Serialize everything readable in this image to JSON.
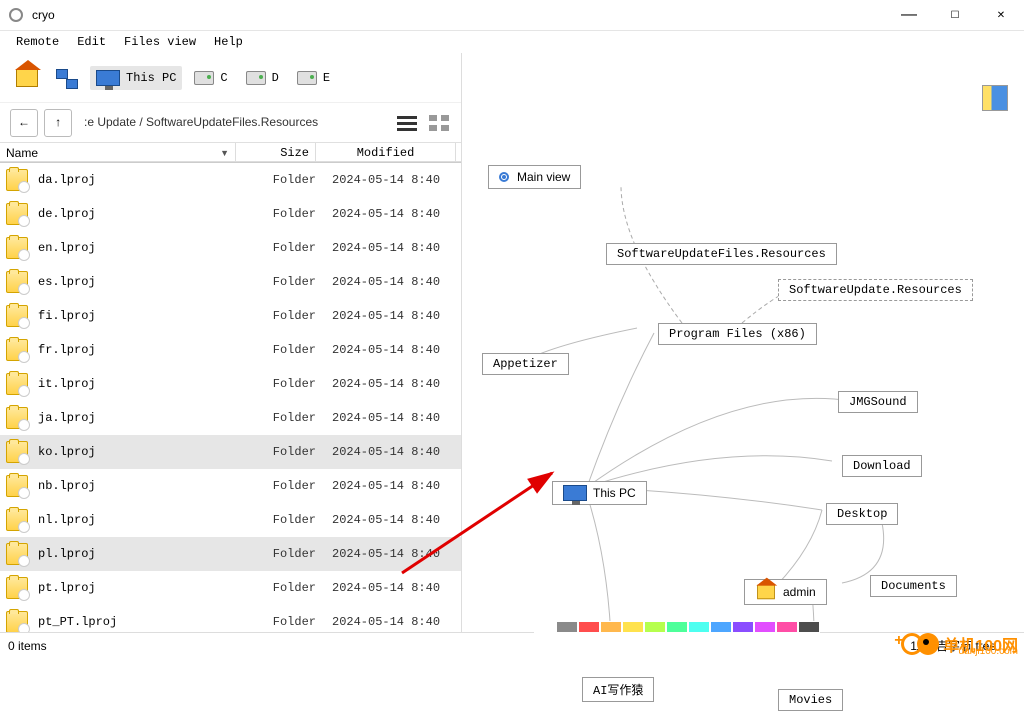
{
  "window": {
    "title": "cryo"
  },
  "menubar": {
    "items": [
      "Remote",
      "Edit",
      "Files view",
      "Help"
    ]
  },
  "toolbar": {
    "home": "",
    "thispc_label": "This PC",
    "drives": [
      {
        "label": "C"
      },
      {
        "label": "D"
      },
      {
        "label": "E"
      }
    ]
  },
  "nav": {
    "back": "←",
    "up": "↑",
    "breadcrumb_prefix": ":e Update / ",
    "breadcrumb": "SoftwareUpdateFiles.Resources"
  },
  "columns": {
    "name": "Name",
    "size": "Size",
    "modified": "Modified"
  },
  "rows": [
    {
      "name": "da.lproj",
      "size": "Folder",
      "modified": "2024-05-14  8:40",
      "selected": false
    },
    {
      "name": "de.lproj",
      "size": "Folder",
      "modified": "2024-05-14  8:40",
      "selected": false
    },
    {
      "name": "en.lproj",
      "size": "Folder",
      "modified": "2024-05-14  8:40",
      "selected": false
    },
    {
      "name": "es.lproj",
      "size": "Folder",
      "modified": "2024-05-14  8:40",
      "selected": false
    },
    {
      "name": "fi.lproj",
      "size": "Folder",
      "modified": "2024-05-14  8:40",
      "selected": false
    },
    {
      "name": "fr.lproj",
      "size": "Folder",
      "modified": "2024-05-14  8:40",
      "selected": false
    },
    {
      "name": "it.lproj",
      "size": "Folder",
      "modified": "2024-05-14  8:40",
      "selected": false
    },
    {
      "name": "ja.lproj",
      "size": "Folder",
      "modified": "2024-05-14  8:40",
      "selected": false
    },
    {
      "name": "ko.lproj",
      "size": "Folder",
      "modified": "2024-05-14  8:40",
      "selected": true
    },
    {
      "name": "nb.lproj",
      "size": "Folder",
      "modified": "2024-05-14  8:40",
      "selected": false
    },
    {
      "name": "nl.lproj",
      "size": "Folder",
      "modified": "2024-05-14  8:40",
      "selected": false
    },
    {
      "name": "pl.lproj",
      "size": "Folder",
      "modified": "2024-05-14  8:40",
      "selected": true
    },
    {
      "name": "pt.lproj",
      "size": "Folder",
      "modified": "2024-05-14  8:40",
      "selected": false
    },
    {
      "name": "pt_PT.lproj",
      "size": "Folder",
      "modified": "2024-05-14  8:40",
      "selected": false
    }
  ],
  "statusbar": {
    "items": "0 items",
    "free": "11.8 吉字节 free"
  },
  "graph": {
    "main_view": "Main view",
    "nodes": {
      "swuf": "SoftwareUpdateFiles.Resources",
      "swur": "SoftwareUpdate.Resources",
      "pf86": "Program Files (x86)",
      "appetizer": "Appetizer",
      "thispc": "This PC",
      "jmgsound": "JMGSound",
      "download": "Download",
      "desktop": "Desktop",
      "admin": "admin",
      "documents": "Documents",
      "aiwriter": "AI写作猿",
      "movies": "Movies"
    }
  },
  "palette_colors": [
    "#ffffff",
    "#8a8a8a",
    "#ff4d4d",
    "#ffb84d",
    "#ffe24d",
    "#b6ff4d",
    "#4dff9a",
    "#4dfff0",
    "#4da6ff",
    "#8a4dff",
    "#e24dff",
    "#ff4da6",
    "#4d4d4d"
  ],
  "logo": {
    "text": "单机100网",
    "sub": "danji100.com"
  }
}
